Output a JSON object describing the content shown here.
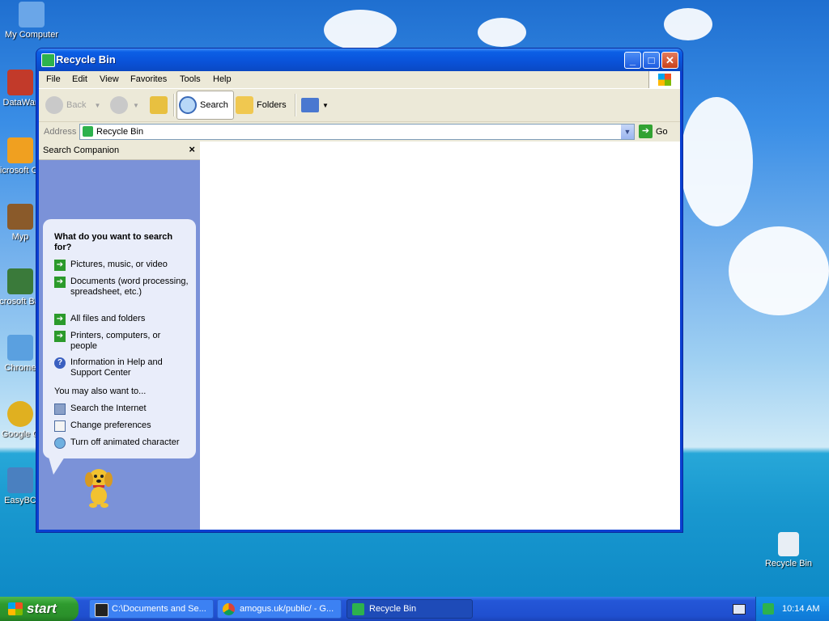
{
  "desktop": {
    "icons": [
      {
        "label": "My Computer",
        "icon": "my-computer-icon",
        "color": "#6aa6e8"
      },
      {
        "label": "DataWar",
        "icon": "datawar-shortcut-icon",
        "color": "#c23a2a"
      },
      {
        "label": "Microsoft C++",
        "icon": "msvc-shortcut-icon",
        "color": "#f0a020"
      },
      {
        "label": "Myp",
        "icon": "myp-shortcut-icon",
        "color": "#8a5a2a"
      },
      {
        "label": "Microsoft Basic",
        "icon": "msbasic-shortcut-icon",
        "color": "#3a7a3a"
      },
      {
        "label": "Chrome",
        "icon": "chrome-setup-icon",
        "color": "#5aa0e0"
      },
      {
        "label": "Google C",
        "icon": "google-chrome-icon",
        "color": "#e0b020"
      },
      {
        "label": "EasyBC",
        "icon": "easybcd-shortcut-icon",
        "color": "#4a80c0"
      },
      {
        "label": "Recycle Bin",
        "icon": "recycle-bin-icon",
        "color": "#e8eef5"
      }
    ]
  },
  "window": {
    "title": "Recycle Bin",
    "menu": [
      "File",
      "Edit",
      "View",
      "Favorites",
      "Tools",
      "Help"
    ],
    "toolbar": {
      "back": "Back",
      "search": "Search",
      "folders": "Folders"
    },
    "address": {
      "label": "Address",
      "value": "Recycle Bin",
      "go": "Go"
    },
    "search_pane": {
      "title": "Search Companion",
      "close": "×",
      "question": "What do you want to search for?",
      "options": [
        "Pictures, music, or video",
        "Documents (word processing, spreadsheet, etc.)",
        "All files and folders",
        "Printers, computers, or people",
        "Information in Help and Support Center"
      ],
      "also_label": "You may also want to...",
      "also_options": [
        "Search the Internet",
        "Change preferences",
        "Turn off animated character"
      ]
    }
  },
  "taskbar": {
    "start": "start",
    "tasks": [
      {
        "label": "C:\\Documents and Se...",
        "icon": "7zip-icon"
      },
      {
        "label": "amogus.uk/public/ - G...",
        "icon": "chrome-icon"
      },
      {
        "label": "Recycle Bin",
        "icon": "recycle-bin-icon"
      }
    ],
    "clock": "10:14 AM"
  },
  "colors": {
    "xp_blue": "#0a52d8",
    "pane_blue": "#7b92d8",
    "start_green": "#2e9b2e",
    "close_red": "#c8411b"
  }
}
